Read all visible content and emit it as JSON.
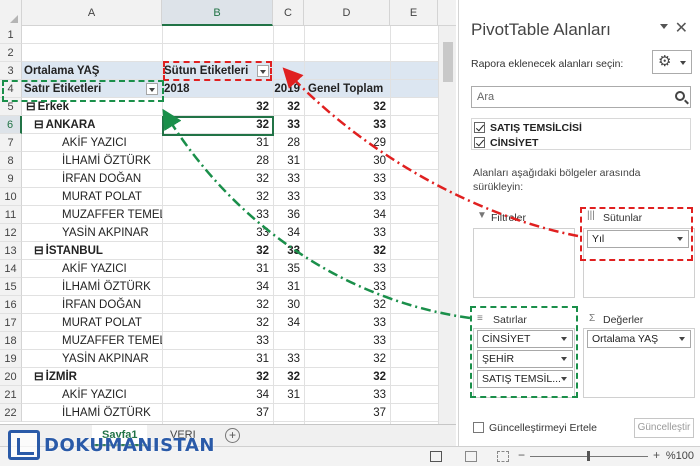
{
  "sheet": {
    "columns": [
      "A",
      "B",
      "C",
      "D",
      "E"
    ],
    "active_column": "B",
    "active_row": "6",
    "rows": [
      {
        "num": "1",
        "a": "",
        "b": "",
        "c": "",
        "d": ""
      },
      {
        "num": "2",
        "a": "",
        "b": "",
        "c": "",
        "d": ""
      },
      {
        "num": "3",
        "a": "Ortalama YAŞ",
        "b": "Sütun Etiketleri",
        "c": "",
        "d": ""
      },
      {
        "num": "4",
        "a": "Satır Etiketleri",
        "b": "2018",
        "c": "2019",
        "d": "Genel Toplam"
      },
      {
        "num": "5",
        "a": "Erkek",
        "b": "32",
        "c": "32",
        "d": "32"
      },
      {
        "num": "6",
        "a": "ANKARA",
        "b": "32",
        "c": "33",
        "d": "33"
      },
      {
        "num": "7",
        "a": "AKİF YAZICI",
        "b": "31",
        "c": "28",
        "d": "29"
      },
      {
        "num": "8",
        "a": "İLHAMİ ÖZTÜRK",
        "b": "28",
        "c": "31",
        "d": "30"
      },
      {
        "num": "9",
        "a": "İRFAN DOĞAN",
        "b": "32",
        "c": "33",
        "d": "33"
      },
      {
        "num": "10",
        "a": "MURAT POLAT",
        "b": "32",
        "c": "33",
        "d": "33"
      },
      {
        "num": "11",
        "a": "MUZAFFER TEMEL",
        "b": "33",
        "c": "36",
        "d": "34"
      },
      {
        "num": "12",
        "a": "YASİN AKPINAR",
        "b": "33",
        "c": "34",
        "d": "33"
      },
      {
        "num": "13",
        "a": "İSTANBUL",
        "b": "32",
        "c": "33",
        "d": "32"
      },
      {
        "num": "14",
        "a": "AKİF YAZICI",
        "b": "31",
        "c": "35",
        "d": "33"
      },
      {
        "num": "15",
        "a": "İLHAMİ ÖZTÜRK",
        "b": "34",
        "c": "31",
        "d": "33"
      },
      {
        "num": "16",
        "a": "İRFAN DOĞAN",
        "b": "32",
        "c": "30",
        "d": "32"
      },
      {
        "num": "17",
        "a": "MURAT POLAT",
        "b": "32",
        "c": "34",
        "d": "33"
      },
      {
        "num": "18",
        "a": "MUZAFFER TEMEL",
        "b": "33",
        "c": "",
        "d": "33"
      },
      {
        "num": "19",
        "a": "YASİN AKPINAR",
        "b": "31",
        "c": "33",
        "d": "32"
      },
      {
        "num": "20",
        "a": "İZMİR",
        "b": "32",
        "c": "32",
        "d": "32"
      },
      {
        "num": "21",
        "a": "AKİF YAZICI",
        "b": "34",
        "c": "31",
        "d": "33"
      },
      {
        "num": "22",
        "a": "İLHAMİ ÖZTÜRK",
        "b": "37",
        "c": "",
        "d": "37"
      }
    ]
  },
  "sheet_tabs": [
    "Sayfa1",
    "VERI"
  ],
  "active_tab": "Sayfa1",
  "pane": {
    "title": "PivotTable Alanları",
    "choose_fields": "Rapora eklenecek alanları seçin:",
    "search_placeholder": "Ara",
    "fields": [
      "SATIŞ TEMSİLCİSİ",
      "CİNSİYET"
    ],
    "drag_note": "Alanları aşağıdaki bölgeler arasında sürükleyin:",
    "filters_label": "Filtreler",
    "columns_label": "Sütunlar",
    "rows_label": "Satırlar",
    "values_label": "Değerler",
    "columns_items": [
      "Yıl"
    ],
    "rows_items": [
      "CİNSİYET",
      "ŞEHİR",
      "SATIŞ TEMSİL..."
    ],
    "values_items": [
      "Ortalama YAŞ"
    ],
    "defer_label": "Güncelleştirmeyi Ertele",
    "update_button": "Güncelleştir"
  },
  "status": {
    "zoom": "%100"
  },
  "logo": {
    "text": "DOKUMANISTAN"
  },
  "colors": {
    "accent": "#217346",
    "annot_red": "#e02020",
    "annot_green": "#1a8f4a"
  }
}
